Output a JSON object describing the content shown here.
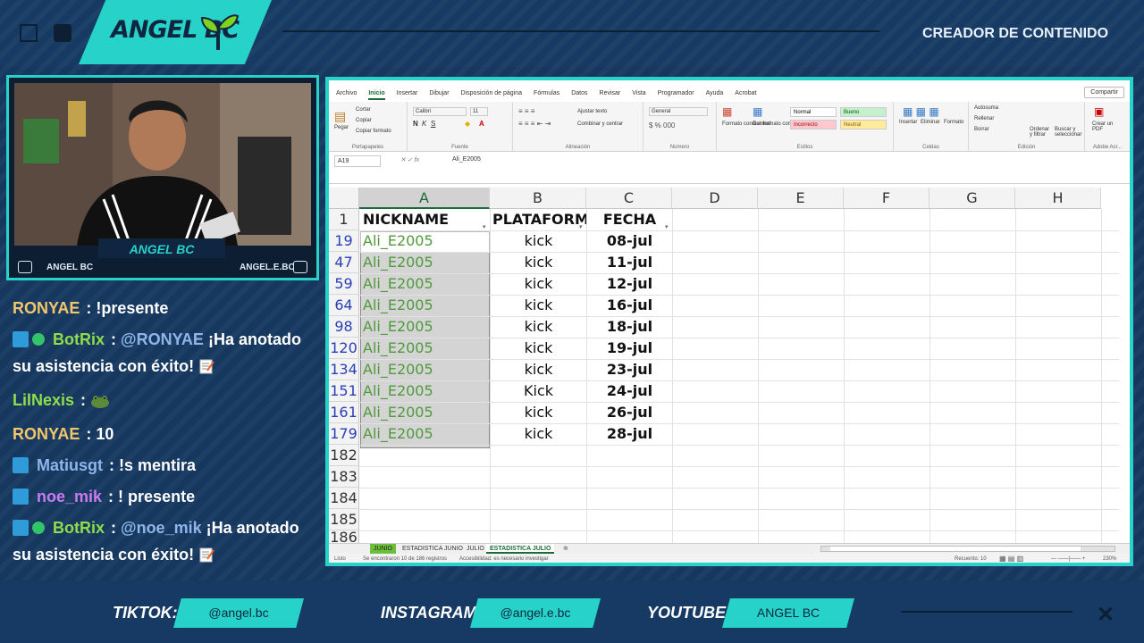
{
  "overlay": {
    "logo_text": "ANGEL BC",
    "top_right_title": "CREADOR DE CONTENIDO",
    "cam_name": "ANGEL BC",
    "cam_social_left": "ANGEL BC",
    "cam_social_right": "ANGEL.E.BC",
    "accent_color": "#27d3c9",
    "bg_color": "#163a63"
  },
  "chat": [
    {
      "badges": [],
      "user": "RONYAE",
      "user_color": "#f2c66d",
      "message": "!presente"
    },
    {
      "badges": [
        "mod",
        "verified"
      ],
      "user": "BotRix",
      "user_color": "#8ddd4c",
      "mention": "@RONYAE",
      "message": "¡Ha anotado su asistencia con éxito!",
      "emoji": "memo-icon"
    },
    {
      "badges": [],
      "user": "LilNexis",
      "user_color": "#8ddd4c",
      "message": "",
      "emoji": "frog-icon"
    },
    {
      "badges": [],
      "user": "RONYAE",
      "user_color": "#f2c66d",
      "message": "10"
    },
    {
      "badges": [
        "mod"
      ],
      "user": "Matiusgt",
      "user_color": "#8fb6ea",
      "message": "!s mentira"
    },
    {
      "badges": [
        "mod"
      ],
      "user": "noe_mik",
      "user_color": "#c97cf0",
      "message": "! presente"
    },
    {
      "badges": [
        "mod",
        "verified"
      ],
      "user": "BotRix",
      "user_color": "#8ddd4c",
      "mention": "@noe_mik",
      "message": "¡Ha anotado su asistencia con éxito!",
      "emoji": "memo-icon"
    }
  ],
  "bottom": {
    "tiktok_label": "TIKTOK:",
    "tiktok_handle": "@angel.bc",
    "instagram_label": "INSTAGRAM:",
    "instagram_handle": "@angel.e.bc",
    "youtube_label": "YOUTUBE:",
    "youtube_handle": "ANGEL BC"
  },
  "excel": {
    "menu_tabs": [
      "Archivo",
      "Inicio",
      "Insertar",
      "Dibujar",
      "Disposición de página",
      "Fórmulas",
      "Datos",
      "Revisar",
      "Vista",
      "Programador",
      "Ayuda",
      "Acrobat"
    ],
    "active_tab": "Inicio",
    "share_label": "Compartir",
    "ribbon": {
      "clipboard": {
        "paste": "Pegar",
        "cut": "Cortar",
        "copy": "Copiar",
        "format_painter": "Copiar formato",
        "caption": "Portapapeles"
      },
      "font": {
        "name": "Calibri",
        "size": "11",
        "caption": "Fuente"
      },
      "alignment": {
        "wrap": "Ajustar texto",
        "merge": "Combinar y centrar",
        "caption": "Alineación"
      },
      "number": {
        "format": "General",
        "caption": "Número"
      },
      "styles": {
        "conditional": "Formato condicional",
        "table": "Dar formato como tabla",
        "normal": "Normal",
        "good": "Bueno",
        "bad": "Incorrecto",
        "neutral": "Neutral",
        "caption": "Estilos"
      },
      "cells": {
        "insert": "Insertar",
        "delete": "Eliminar",
        "format": "Formato",
        "caption": "Celdas"
      },
      "editing": {
        "autosum": "Autosuma",
        "fill": "Rellenar",
        "clear": "Borrar",
        "sort": "Ordenar y filtrar",
        "find": "Buscar y seleccionar",
        "caption": "Edición"
      },
      "adobe": {
        "create_pdf": "Crear un PDF",
        "caption": "Adobe Acr..."
      }
    },
    "name_box": "A19",
    "formula_value": "Ali_E2005",
    "columns": [
      "A",
      "B",
      "C",
      "D",
      "E",
      "F",
      "G",
      "H"
    ],
    "header_row": {
      "row": "1",
      "cells": [
        "NICKNAME",
        "PLATAFORMA",
        "FECHA"
      ]
    },
    "rows": [
      {
        "row": "19",
        "nickname": "Ali_E2005",
        "platform": "kick",
        "date": "08-jul"
      },
      {
        "row": "47",
        "nickname": "Ali_E2005",
        "platform": "kick",
        "date": "11-jul"
      },
      {
        "row": "59",
        "nickname": "Ali_E2005",
        "platform": "kick",
        "date": "12-jul"
      },
      {
        "row": "64",
        "nickname": "Ali_E2005",
        "platform": "kick",
        "date": "16-jul"
      },
      {
        "row": "98",
        "nickname": "Ali_E2005",
        "platform": "kick",
        "date": "18-jul"
      },
      {
        "row": "120",
        "nickname": "Ali_E2005",
        "platform": "kick",
        "date": "19-jul"
      },
      {
        "row": "134",
        "nickname": "Ali_E2005",
        "platform": "kick",
        "date": "23-jul"
      },
      {
        "row": "151",
        "nickname": "Ali_E2005",
        "platform": "Kick",
        "date": "24-jul"
      },
      {
        "row": "161",
        "nickname": "Ali_E2005",
        "platform": "kick",
        "date": "26-jul"
      },
      {
        "row": "179",
        "nickname": "Ali_E2005",
        "platform": "kick",
        "date": "28-jul"
      }
    ],
    "empty_rows": [
      "182",
      "183",
      "184",
      "185",
      "186"
    ],
    "sheet_tabs": [
      "JUNIO",
      "ESTADISTICA JUNIO",
      "JULIO",
      "ESTADISTICA JULIO"
    ],
    "active_sheet": "ESTADISTICA JULIO",
    "status_left": "Listo",
    "status_records": "Se encontraron 10 de 186 registros",
    "status_accessibility": "Accesibilidad: es necesario investigar",
    "status_count": "Recuento: 10",
    "zoom": "230%"
  }
}
